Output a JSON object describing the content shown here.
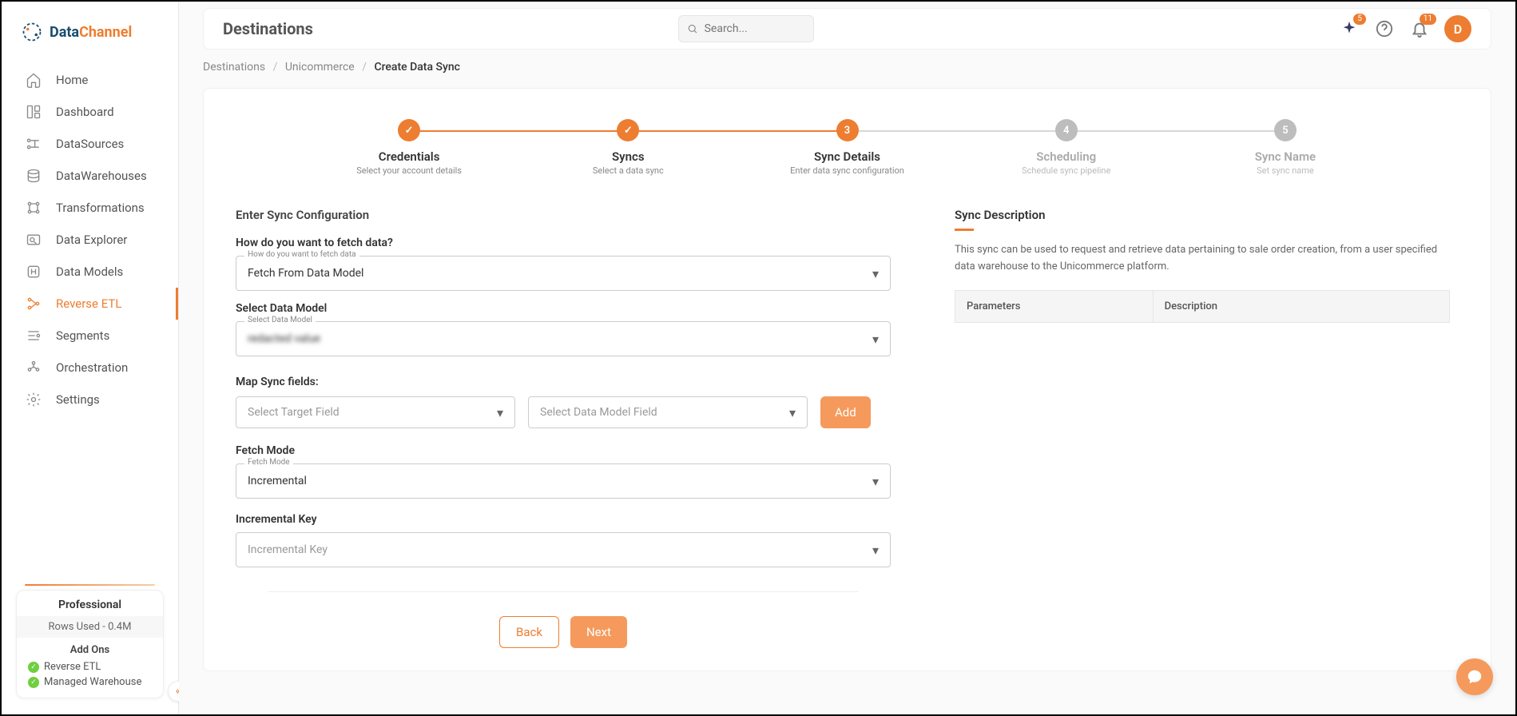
{
  "brand": {
    "part1": "Data",
    "part2": "Channel"
  },
  "sidebar": {
    "items": [
      {
        "label": "Home"
      },
      {
        "label": "Dashboard"
      },
      {
        "label": "DataSources"
      },
      {
        "label": "DataWarehouses"
      },
      {
        "label": "Transformations"
      },
      {
        "label": "Data Explorer"
      },
      {
        "label": "Data Models"
      },
      {
        "label": "Reverse ETL"
      },
      {
        "label": "Segments"
      },
      {
        "label": "Orchestration"
      },
      {
        "label": "Settings"
      }
    ]
  },
  "plan": {
    "title": "Professional",
    "rows_used": "Rows Used - 0.4M",
    "addons_label": "Add Ons",
    "addons": [
      {
        "label": "Reverse ETL"
      },
      {
        "label": "Managed Warehouse"
      }
    ]
  },
  "header": {
    "title": "Destinations",
    "search_placeholder": "Search...",
    "sparkle_badge": "5",
    "bell_badge": "11",
    "avatar_letter": "D"
  },
  "breadcrumb": {
    "a": "Destinations",
    "b": "Unicommerce",
    "c": "Create Data Sync"
  },
  "steps": [
    {
      "title": "Credentials",
      "sub": "Select your account details",
      "state": "done"
    },
    {
      "title": "Syncs",
      "sub": "Select a data sync",
      "state": "done"
    },
    {
      "title": "Sync Details",
      "sub": "Enter data sync configuration",
      "state": "active",
      "num": "3"
    },
    {
      "title": "Scheduling",
      "sub": "Schedule sync pipeline",
      "state": "future",
      "num": "4"
    },
    {
      "title": "Sync Name",
      "sub": "Set sync name",
      "state": "future",
      "num": "5"
    }
  ],
  "form": {
    "section_title": "Enter Sync Configuration",
    "fetch_label": "How do you want to fetch data?",
    "fetch_floating": "How do you want to fetch data",
    "fetch_value": "Fetch From Data Model",
    "model_label": "Select Data Model",
    "model_floating": "Select Data Model",
    "model_value": "redacted value",
    "map_label": "Map Sync fields:",
    "target_placeholder": "Select Target Field",
    "model_field_placeholder": "Select Data Model Field",
    "add_label": "Add",
    "fetch_mode_label": "Fetch Mode",
    "fetch_mode_floating": "Fetch Mode",
    "fetch_mode_value": "Incremental",
    "inc_key_label": "Incremental Key",
    "inc_key_placeholder": "Incremental Key",
    "back": "Back",
    "next": "Next"
  },
  "desc": {
    "title": "Sync Description",
    "text": "This sync can be used to request and retrieve data pertaining to sale order creation, from a user specified data warehouse to the Unicommerce platform.",
    "col1": "Parameters",
    "col2": "Description"
  }
}
